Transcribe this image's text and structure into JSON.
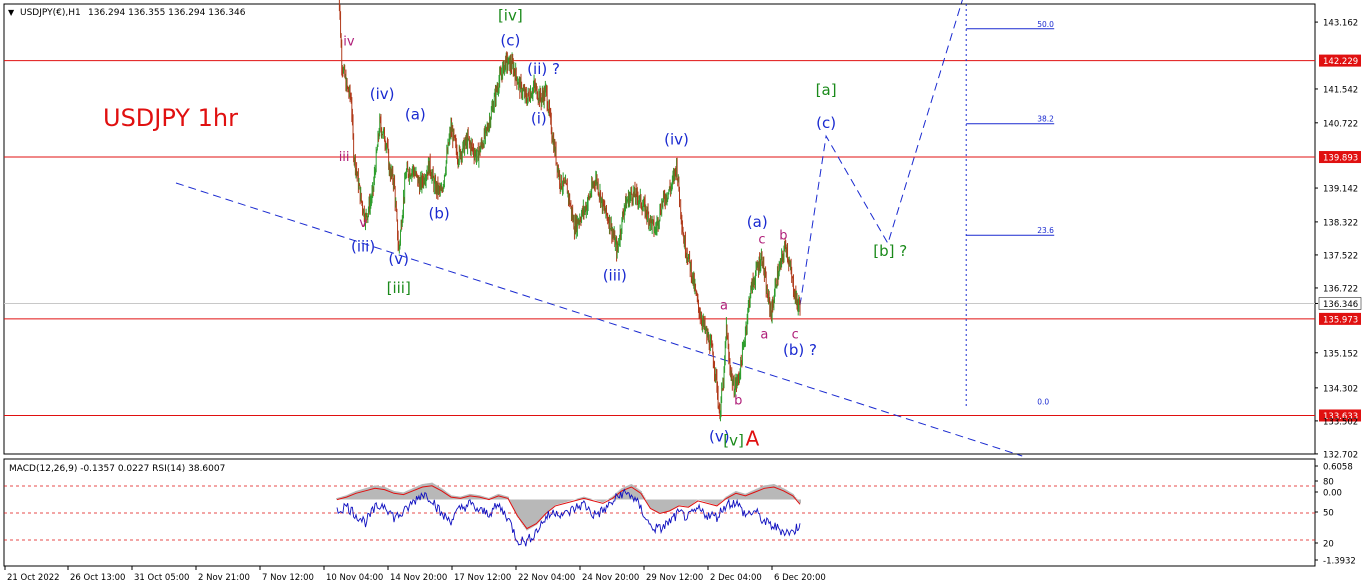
{
  "header": {
    "symbol": "USDJPY(€),H1",
    "ohlc": "136.294 136.355 136.294 136.346",
    "title": "USDJPY 1hr"
  },
  "colors": {
    "bull": "#2e9e2e",
    "bear": "#b03a1a",
    "hline": "#e01010",
    "wave_blue": "#1a2ad0",
    "wave_green": "#1a8a1a",
    "wave_magenta": "#b0207a",
    "annot_red": "#e01010",
    "macd_hist": "#b8b8b8",
    "rsi_line": "#1010c0",
    "signal_line": "#e01010"
  },
  "chart_data": [
    {
      "type": "candlestick",
      "title": "USDJPY 1hr",
      "ylim": [
        132.7,
        143.6
      ],
      "y_ticks": [
        "143.162",
        "142.229",
        "141.542",
        "140.722",
        "139.893",
        "139.142",
        "138.322",
        "137.522",
        "136.722",
        "136.346",
        "135.973",
        "135.152",
        "134.302",
        "133.633",
        "133.502",
        "132.702"
      ],
      "price_tag": "136.346",
      "x_ticks": [
        "21 Oct 2022",
        "26 Oct 13:00",
        "31 Oct 05:00",
        "2 Nov 21:00",
        "7 Nov 12:00",
        "10 Nov 04:00",
        "14 Nov 20:00",
        "17 Nov 12:00",
        "22 Nov 04:00",
        "24 Nov 20:00",
        "29 Nov 12:00",
        "2 Dec 04:00",
        "6 Dec 20:00"
      ],
      "path": [
        [
          0,
          145.0
        ],
        [
          2,
          142.2
        ],
        [
          4,
          141.6
        ],
        [
          6,
          141.3
        ],
        [
          7,
          140.0
        ],
        [
          10,
          138.9
        ],
        [
          12,
          138.4
        ],
        [
          15,
          139.0
        ],
        [
          18,
          140.7
        ],
        [
          21,
          140.2
        ],
        [
          22,
          139.6
        ],
        [
          24,
          139.3
        ],
        [
          26,
          137.6
        ],
        [
          29,
          139.5
        ],
        [
          32,
          139.6
        ],
        [
          35,
          139.2
        ],
        [
          39,
          139.7
        ],
        [
          41,
          139.2
        ],
        [
          44,
          139.0
        ],
        [
          48,
          140.6
        ],
        [
          51,
          139.9
        ],
        [
          55,
          140.3
        ],
        [
          59,
          139.9
        ],
        [
          63,
          140.5
        ],
        [
          68,
          141.7
        ],
        [
          71,
          142.2
        ],
        [
          74,
          142.1
        ],
        [
          77,
          141.6
        ],
        [
          80,
          141.3
        ],
        [
          83,
          141.6
        ],
        [
          86,
          141.3
        ],
        [
          88,
          141.5
        ],
        [
          91,
          140.3
        ],
        [
          94,
          139.3
        ],
        [
          97,
          139.1
        ],
        [
          100,
          138.2
        ],
        [
          105,
          138.7
        ],
        [
          109,
          139.4
        ],
        [
          112,
          138.7
        ],
        [
          115,
          138.3
        ],
        [
          118,
          137.6
        ],
        [
          121,
          138.7
        ],
        [
          124,
          139.0
        ],
        [
          127,
          138.9
        ],
        [
          130,
          138.6
        ],
        [
          134,
          138.1
        ],
        [
          137,
          138.8
        ],
        [
          141,
          139.2
        ],
        [
          143,
          139.7
        ],
        [
          146,
          137.9
        ],
        [
          149,
          137.2
        ],
        [
          152,
          136.3
        ],
        [
          155,
          135.7
        ],
        [
          158,
          135.2
        ],
        [
          160,
          134.4
        ],
        [
          161,
          133.63
        ],
        [
          163,
          134.6
        ],
        [
          164,
          135.8
        ],
        [
          165,
          135.0
        ],
        [
          167,
          134.3
        ],
        [
          169,
          134.5
        ],
        [
          171,
          135.2
        ],
        [
          174,
          136.6
        ],
        [
          177,
          137.2
        ],
        [
          179,
          137.5
        ],
        [
          181,
          136.6
        ],
        [
          183,
          136.1
        ],
        [
          185,
          136.9
        ],
        [
          187,
          137.3
        ],
        [
          189,
          137.8
        ],
        [
          192,
          136.8
        ],
        [
          194,
          136.3
        ],
        [
          195,
          136.346
        ]
      ],
      "hlines": [
        {
          "price": 142.229,
          "label": "142.229"
        },
        {
          "price": 139.893,
          "label": "139.893"
        },
        {
          "price": 135.973,
          "label": "135.973"
        },
        {
          "price": 133.633,
          "label": "133.633"
        }
      ],
      "fib_levels": [
        {
          "label": "50.0",
          "price": 143.0
        },
        {
          "label": "38.2",
          "price": 140.7
        },
        {
          "label": "23.6",
          "price": 138.0
        },
        {
          "label": "0.0",
          "price": 133.85
        }
      ],
      "projection": [
        {
          "bar": 195,
          "price": 136.3
        },
        {
          "bar": 206,
          "price": 140.4
        },
        {
          "bar": 232,
          "price": 137.8
        },
        {
          "bar": 265,
          "price": 144.0
        }
      ],
      "trendline": [
        {
          "bar": 0,
          "price": 139.3
        },
        {
          "bar": 265,
          "price": 132.7
        }
      ],
      "wave_labels": [
        {
          "text": "iv",
          "bar": 5,
          "price": 142.6,
          "color": "magenta"
        },
        {
          "text": "iii",
          "bar": 3,
          "price": 139.8,
          "color": "magenta"
        },
        {
          "text": "v",
          "bar": 11,
          "price": 138.2,
          "color": "magenta"
        },
        {
          "text": "(iii)",
          "bar": 11,
          "price": 137.6,
          "color": "blue"
        },
        {
          "text": "(iv)",
          "bar": 19,
          "price": 141.3,
          "color": "blue"
        },
        {
          "text": "(v)",
          "bar": 26,
          "price": 137.3,
          "color": "blue"
        },
        {
          "text": "[iii]",
          "bar": 26,
          "price": 136.6,
          "color": "green"
        },
        {
          "text": "(a)",
          "bar": 33,
          "price": 140.8,
          "color": "blue"
        },
        {
          "text": "(b)",
          "bar": 43,
          "price": 138.4,
          "color": "blue"
        },
        {
          "text": "[iv]",
          "bar": 73,
          "price": 143.2,
          "color": "green"
        },
        {
          "text": "(c)",
          "bar": 73,
          "price": 142.6,
          "color": "blue"
        },
        {
          "text": "(ii) ?",
          "bar": 87,
          "price": 141.9,
          "color": "blue"
        },
        {
          "text": "(i)",
          "bar": 85,
          "price": 140.7,
          "color": "blue"
        },
        {
          "text": "(iv)",
          "bar": 143,
          "price": 140.2,
          "color": "blue"
        },
        {
          "text": "(iii)",
          "bar": 117,
          "price": 136.9,
          "color": "blue"
        },
        {
          "text": "a",
          "bar": 163,
          "price": 136.2,
          "color": "magenta"
        },
        {
          "text": "b",
          "bar": 169,
          "price": 133.9,
          "color": "magenta"
        },
        {
          "text": "(v)",
          "bar": 161,
          "price": 133.0,
          "color": "blue"
        },
        {
          "text": "[v]",
          "bar": 167,
          "price": 132.9,
          "color": "green"
        },
        {
          "text": "A",
          "bar": 175,
          "price": 132.9,
          "color": "red"
        },
        {
          "text": "(a)",
          "bar": 177,
          "price": 138.2,
          "color": "blue"
        },
        {
          "text": "c",
          "bar": 179,
          "price": 137.8,
          "color": "magenta"
        },
        {
          "text": "b",
          "bar": 188,
          "price": 137.9,
          "color": "magenta"
        },
        {
          "text": "a",
          "bar": 180,
          "price": 135.5,
          "color": "magenta"
        },
        {
          "text": "c",
          "bar": 193,
          "price": 135.5,
          "color": "magenta"
        },
        {
          "text": "(b) ?",
          "bar": 195,
          "price": 135.1,
          "color": "blue"
        },
        {
          "text": "[a]",
          "bar": 206,
          "price": 141.4,
          "color": "green"
        },
        {
          "text": "(c)",
          "bar": 206,
          "price": 140.6,
          "color": "blue"
        },
        {
          "text": "[b] ?",
          "bar": 233,
          "price": 137.5,
          "color": "green"
        }
      ]
    },
    {
      "type": "line",
      "title": "MACD(12,26,9) -0.1357 0.0227 RSI(14) 38.6007",
      "y_ticks": [
        "0.6058",
        "80",
        "0.00",
        "50",
        "20",
        "-1.3932"
      ],
      "rsi_levels": [
        80,
        50,
        20
      ],
      "series": [
        {
          "name": "RSI(14)",
          "x": [
            0,
            4,
            8,
            12,
            16,
            20,
            24,
            28,
            32,
            36,
            40,
            44,
            48,
            52,
            56,
            60,
            64,
            68,
            72,
            76,
            80,
            84,
            88,
            92,
            96,
            100,
            104,
            108,
            112,
            116,
            120,
            124,
            128,
            132,
            136,
            140,
            144,
            148,
            152,
            156,
            160,
            164,
            168,
            172,
            176,
            180,
            184,
            188,
            192,
            195
          ],
          "values": [
            52,
            58,
            48,
            40,
            55,
            60,
            45,
            50,
            62,
            72,
            66,
            48,
            42,
            55,
            60,
            52,
            50,
            58,
            45,
            20,
            18,
            30,
            45,
            52,
            48,
            55,
            60,
            48,
            52,
            62,
            72,
            70,
            55,
            35,
            32,
            40,
            50,
            45,
            54,
            48,
            46,
            60,
            62,
            48,
            52,
            40,
            35,
            30,
            28,
            38.6
          ]
        },
        {
          "name": "MACD",
          "x": [
            0,
            4,
            8,
            12,
            16,
            20,
            24,
            28,
            32,
            36,
            40,
            44,
            48,
            52,
            56,
            60,
            64,
            68,
            72,
            76,
            80,
            84,
            88,
            92,
            96,
            100,
            104,
            108,
            112,
            116,
            120,
            124,
            128,
            132,
            136,
            140,
            144,
            148,
            152,
            156,
            160,
            164,
            168,
            172,
            176,
            180,
            184,
            188,
            192,
            195
          ],
          "values": [
            0.05,
            0.15,
            0.3,
            0.4,
            0.5,
            0.45,
            0.3,
            0.25,
            0.4,
            0.55,
            0.6,
            0.4,
            0.15,
            0.1,
            0.2,
            0.15,
            0.05,
            0.2,
            0.1,
            -0.6,
            -1.1,
            -0.9,
            -0.5,
            -0.2,
            -0.1,
            0.0,
            0.1,
            0.0,
            -0.1,
            0.1,
            0.4,
            0.55,
            0.3,
            -0.3,
            -0.5,
            -0.4,
            -0.2,
            -0.25,
            0.0,
            -0.1,
            -0.2,
            0.1,
            0.3,
            0.2,
            0.35,
            0.5,
            0.55,
            0.4,
            0.2,
            -0.1357
          ]
        }
      ]
    }
  ]
}
